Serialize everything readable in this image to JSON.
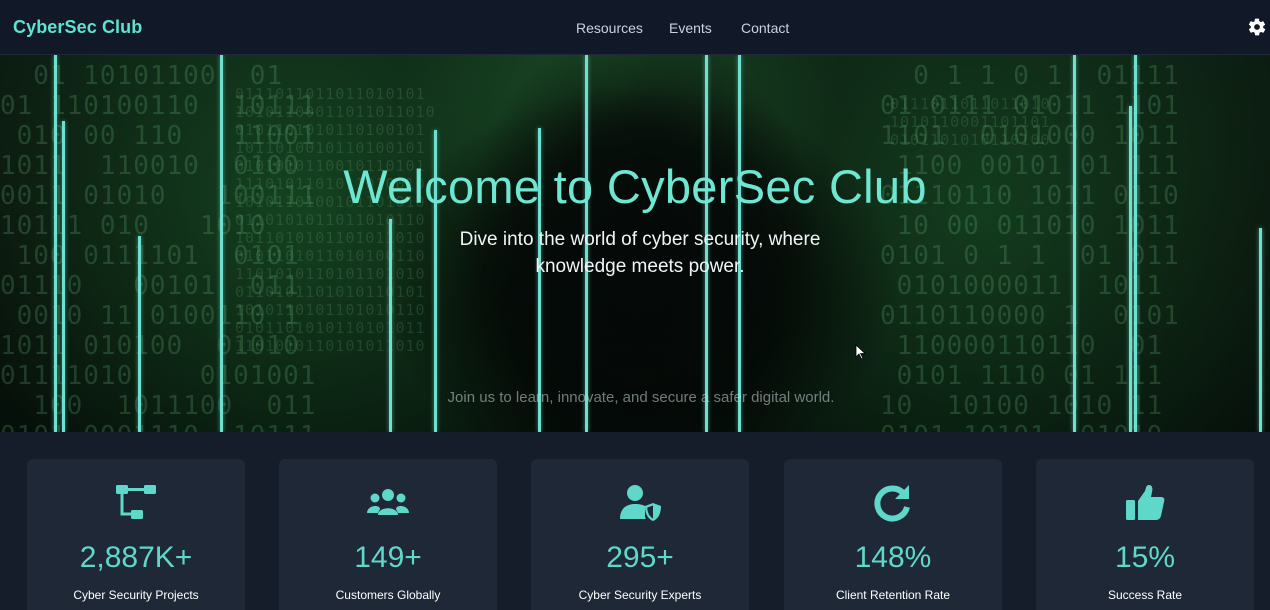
{
  "brand": {
    "name": "CyberSec Club",
    "accent_color": "#5fe3d1"
  },
  "nav": {
    "links": [
      "Resources",
      "Events",
      "Contact"
    ],
    "settings_icon": "gear-icon"
  },
  "hero": {
    "title": "Welcome to CyberSec Club",
    "subtitle": "Dive into the world of cyber security, where knowledge meets power.",
    "tagline": "Join us to learn, innovate, and secure a safer digital world.",
    "line_color": "#6fe0d0"
  },
  "stats": [
    {
      "icon": "sitemap-icon",
      "value": "2,887K+",
      "label": "Cyber Security Projects"
    },
    {
      "icon": "users-icon",
      "value": "149+",
      "label": "Customers Globally"
    },
    {
      "icon": "user-shield-icon",
      "value": "295+",
      "label": "Cyber Security Experts"
    },
    {
      "icon": "redo-icon",
      "value": "148%",
      "label": "Client Retention Rate"
    },
    {
      "icon": "thumbs-up-icon",
      "value": "15%",
      "label": "Success Rate"
    }
  ]
}
